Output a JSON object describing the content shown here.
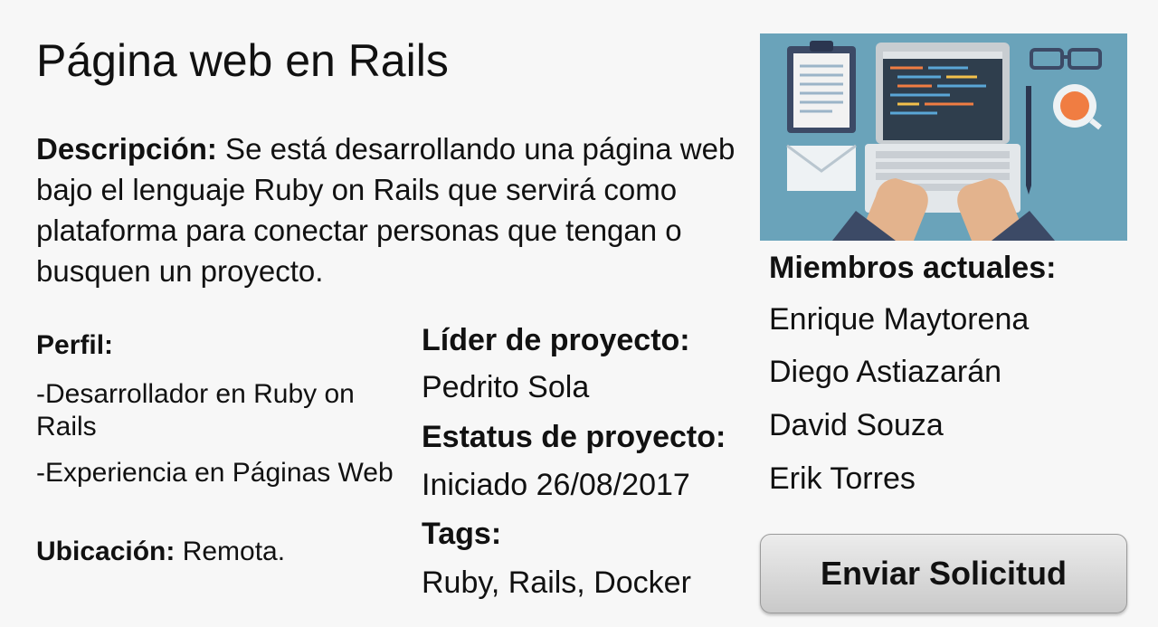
{
  "title": "Página web en Rails",
  "description": {
    "label": "Descripción:",
    "text": " Se está desarrollando una página web bajo el lenguaje Ruby on Rails que servirá como plataforma para conectar personas que tengan o busquen un proyecto."
  },
  "profile": {
    "label": "Perfil:",
    "items": [
      "-Desarrollador en Ruby on Rails",
      "-Experiencia en Páginas Web"
    ]
  },
  "location": {
    "label": "Ubicación:",
    "value": " Remota."
  },
  "leader": {
    "label": "Líder de proyecto:",
    "value": "Pedrito Sola"
  },
  "status": {
    "label": "Estatus de proyecto:",
    "value": "Iniciado 26/08/2017"
  },
  "tags": {
    "label": "Tags:",
    "value": "Ruby, Rails, Docker"
  },
  "members": {
    "label": "Miembros actuales:",
    "items": [
      "Enrique Maytorena",
      "Diego Astiazarán",
      "David Souza",
      "Erik Torres"
    ]
  },
  "button": {
    "label": "Enviar Solicitud"
  },
  "illustration": {
    "icon": "developer-laptop-illustration",
    "colors": {
      "background": "#6aa3ba",
      "laptop": "#d9dde0",
      "screen": "#2f3e4d",
      "mug": "#f07d42",
      "sleeve": "#3c4a66"
    }
  }
}
